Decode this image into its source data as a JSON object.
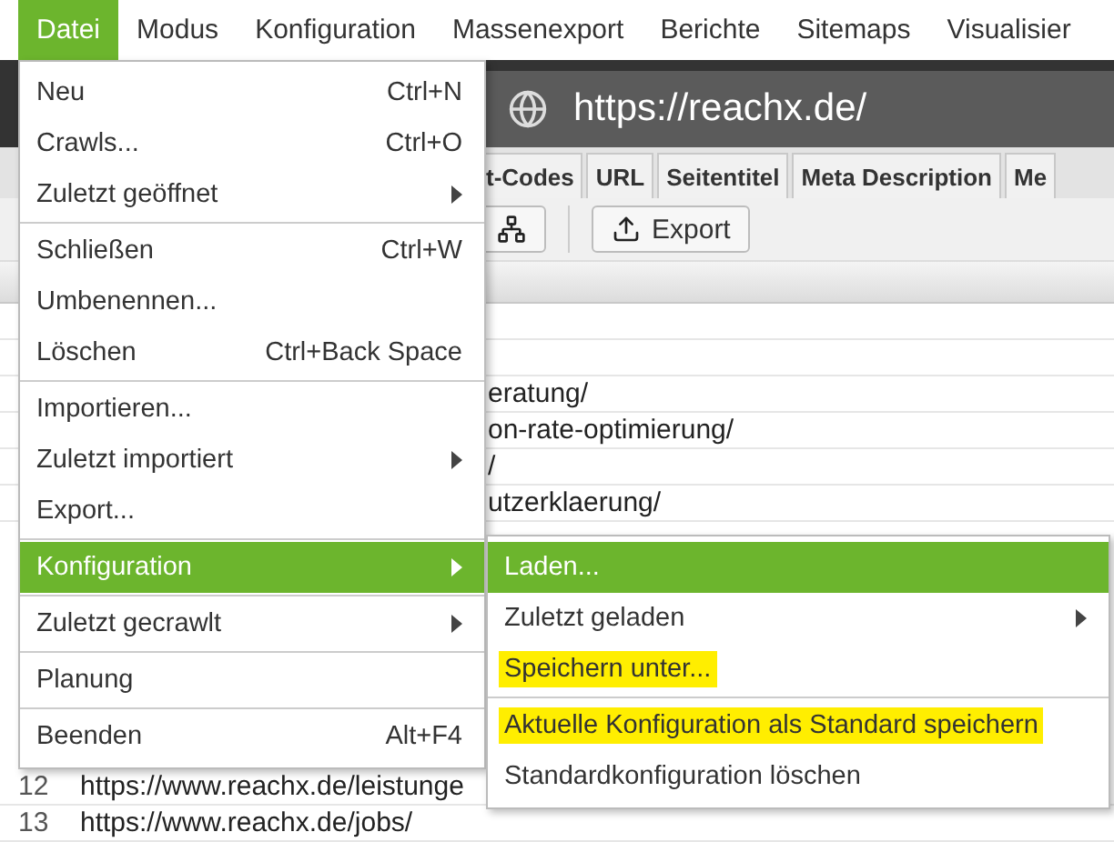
{
  "menubar": [
    {
      "label": "Datei",
      "selected": true
    },
    {
      "label": "Modus",
      "selected": false
    },
    {
      "label": "Konfiguration",
      "selected": false
    },
    {
      "label": "Massenexport",
      "selected": false
    },
    {
      "label": "Berichte",
      "selected": false
    },
    {
      "label": "Sitemaps",
      "selected": false
    },
    {
      "label": "Visualisier",
      "selected": false
    }
  ],
  "address": {
    "url": "https://reachx.de/"
  },
  "tabs": [
    "t-Codes",
    "URL",
    "Seitentitel",
    "Meta Description",
    "Me"
  ],
  "toolbar": {
    "export_label": "Export"
  },
  "table": {
    "rows": [
      {
        "kind": "blank"
      },
      {
        "kind": "blank"
      },
      {
        "kind": "clipped",
        "url": "eratung/"
      },
      {
        "kind": "clipped",
        "url": "on-rate-optimierung/"
      },
      {
        "kind": "clipped",
        "url": "/"
      },
      {
        "kind": "clipped",
        "url": "utzerklaerung/"
      },
      {
        "kind": "full",
        "number": "12",
        "url": "https://www.reachx.de/leistunge"
      },
      {
        "kind": "full",
        "number": "13",
        "url": "https://www.reachx.de/jobs/"
      }
    ]
  },
  "file_menu": {
    "items": [
      {
        "kind": "item",
        "label": "Neu",
        "shortcut": "Ctrl+N",
        "submenu": false,
        "selected": false
      },
      {
        "kind": "item",
        "label": "Crawls...",
        "shortcut": "Ctrl+O",
        "submenu": false,
        "selected": false
      },
      {
        "kind": "item",
        "label": "Zuletzt geöffnet",
        "submenu": true,
        "selected": false
      },
      {
        "kind": "separator"
      },
      {
        "kind": "item",
        "label": "Schließen",
        "shortcut": "Ctrl+W",
        "submenu": false,
        "selected": false
      },
      {
        "kind": "item",
        "label": "Umbenennen...",
        "submenu": false,
        "selected": false
      },
      {
        "kind": "item",
        "label": "Löschen",
        "shortcut": "Ctrl+Back Space",
        "submenu": false,
        "selected": false
      },
      {
        "kind": "separator"
      },
      {
        "kind": "item",
        "label": "Importieren...",
        "submenu": false,
        "selected": false
      },
      {
        "kind": "item",
        "label": "Zuletzt importiert",
        "submenu": true,
        "selected": false
      },
      {
        "kind": "item",
        "label": "Export...",
        "submenu": false,
        "selected": false
      },
      {
        "kind": "separator"
      },
      {
        "kind": "item",
        "label": "Konfiguration",
        "submenu": true,
        "selected": true
      },
      {
        "kind": "separator"
      },
      {
        "kind": "item",
        "label": "Zuletzt gecrawlt",
        "submenu": true,
        "selected": false
      },
      {
        "kind": "separator"
      },
      {
        "kind": "item",
        "label": "Planung",
        "submenu": false,
        "selected": false
      },
      {
        "kind": "separator"
      },
      {
        "kind": "item",
        "label": "Beenden",
        "shortcut": "Alt+F4",
        "submenu": false,
        "selected": false
      }
    ]
  },
  "config_submenu": {
    "items": [
      {
        "kind": "item",
        "label": "Laden...",
        "submenu": false,
        "selected": true,
        "highlighted": false
      },
      {
        "kind": "item",
        "label": "Zuletzt geladen",
        "submenu": true,
        "selected": false,
        "highlighted": false
      },
      {
        "kind": "item",
        "label": "Speichern unter...",
        "submenu": false,
        "selected": false,
        "highlighted": true
      },
      {
        "kind": "separator"
      },
      {
        "kind": "item",
        "label": "Aktuelle Konfiguration als Standard speichern",
        "submenu": false,
        "selected": false,
        "highlighted": true
      },
      {
        "kind": "item",
        "label": "Standardkonfiguration löschen",
        "submenu": false,
        "selected": false,
        "highlighted": false
      }
    ]
  }
}
